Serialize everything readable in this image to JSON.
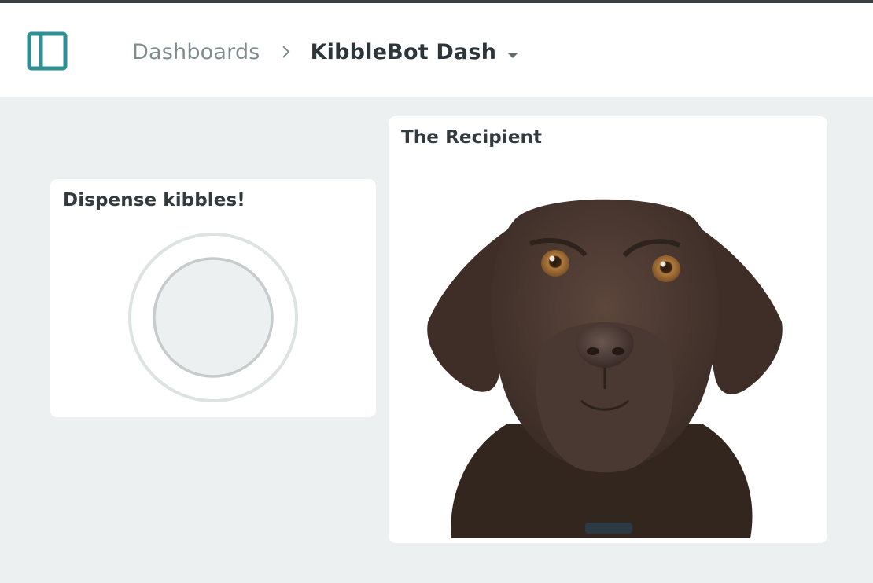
{
  "header": {
    "breadcrumb_root": "Dashboards",
    "breadcrumb_current": "KibbleBot Dash",
    "accent_color": "#2f8f93"
  },
  "widgets": {
    "dispense": {
      "title": "Dispense kibbles!",
      "control": "push-button"
    },
    "recipient": {
      "title": "The Recipient",
      "image": "chocolate-labrador-photo"
    }
  },
  "icons": {
    "sidebar_toggle": "sidebar-panel-icon",
    "separator": "chevron-right-icon",
    "dropdown": "caret-down-icon"
  }
}
